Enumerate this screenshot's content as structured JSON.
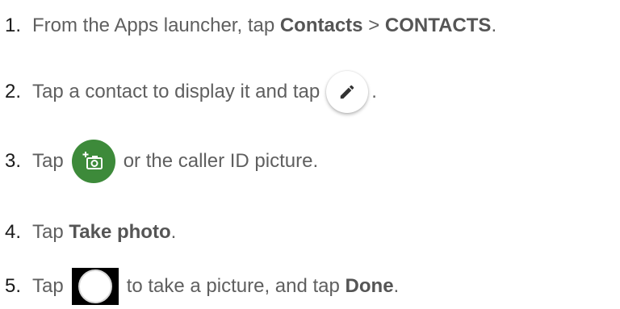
{
  "steps": [
    {
      "number": "1.",
      "parts": {
        "a": "From the Apps launcher, tap ",
        "b": "Contacts",
        "c": " > ",
        "d": "CONTACTS",
        "e": "."
      }
    },
    {
      "number": "2.",
      "parts": {
        "a": "Tap a contact to display it and tap",
        "icon": "edit-pencil-icon",
        "e": "."
      }
    },
    {
      "number": "3.",
      "parts": {
        "a": "Tap",
        "icon": "add-photo-camera-icon",
        "e": "or the caller ID picture."
      }
    },
    {
      "number": "4.",
      "parts": {
        "a": "Tap ",
        "b": "Take photo",
        "e": "."
      }
    },
    {
      "number": "5.",
      "parts": {
        "a": "Tap",
        "icon": "camera-shutter-icon",
        "c": "to take a picture, and tap ",
        "d": "Done",
        "e": "."
      }
    }
  ],
  "colors": {
    "text": "#5f5f5f",
    "number": "#1a1a1a",
    "green_button": "#3d8a3a"
  }
}
